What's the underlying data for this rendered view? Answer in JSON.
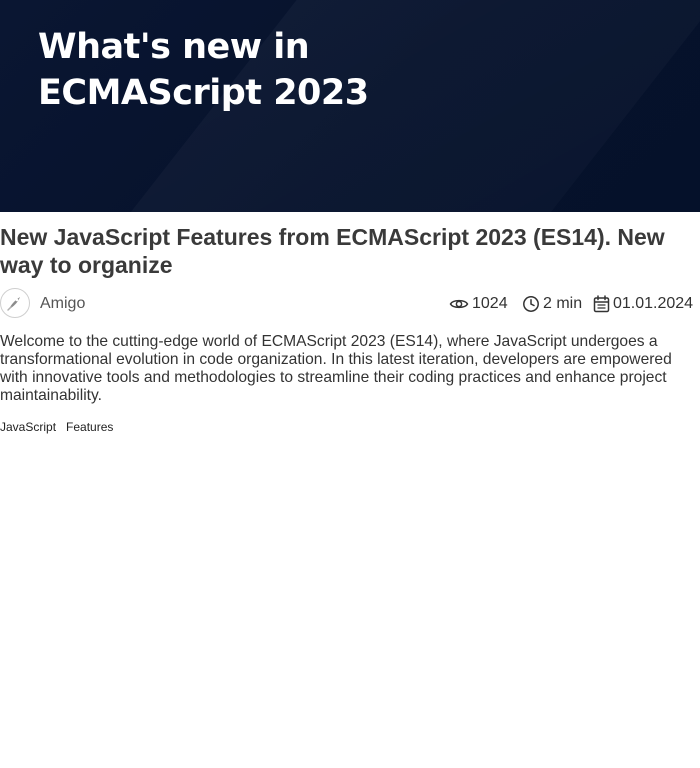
{
  "hero": {
    "title_line1": "What's new in",
    "title_line2": "ECMAScript 2023"
  },
  "article": {
    "title": "New JavaScript Features from ECMAScript 2023 (ES14). New way to organize",
    "author": "Amigo",
    "views": "1024",
    "read_time": "2 min",
    "date": "01.01.2024",
    "excerpt": "Welcome to the cutting-edge world of ECMAScript 2023 (ES14), where JavaScript undergoes a transformational evolution in code organization. In this latest iteration, developers are empowered with innovative tools and methodologies to streamline their coding practices and enhance project maintainability.",
    "tags": [
      "JavaScript",
      "Features"
    ]
  },
  "icons": {
    "views": "eye-icon",
    "read_time": "clock-icon",
    "date": "calendar-icon",
    "avatar": "rocket-avatar-icon"
  },
  "colors": {
    "hero_bg": "#06122c",
    "hero_text": "#ffffff",
    "title_text": "#3a3a3a",
    "body_text": "#333333"
  }
}
